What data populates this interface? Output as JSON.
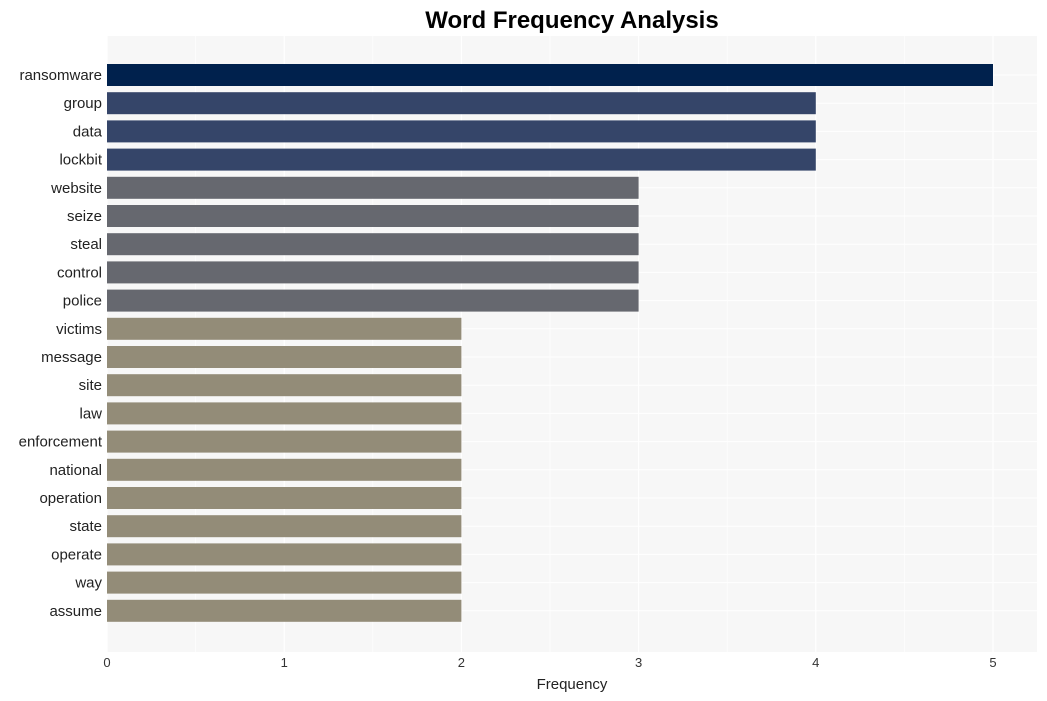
{
  "chart_data": {
    "type": "bar",
    "orientation": "horizontal",
    "title": "Word Frequency Analysis",
    "xlabel": "Frequency",
    "ylabel": "",
    "xlim": [
      0,
      5.25
    ],
    "xticks": [
      0,
      1,
      2,
      3,
      4,
      5
    ],
    "grid": true,
    "legend": "none",
    "categories": [
      "ransomware",
      "group",
      "data",
      "lockbit",
      "website",
      "seize",
      "steal",
      "control",
      "police",
      "victims",
      "message",
      "site",
      "law",
      "enforcement",
      "national",
      "operation",
      "state",
      "operate",
      "way",
      "assume"
    ],
    "values": [
      5,
      4,
      4,
      4,
      3,
      3,
      3,
      3,
      3,
      2,
      2,
      2,
      2,
      2,
      2,
      2,
      2,
      2,
      2,
      2
    ],
    "colors_by_value": {
      "5": "#00214d",
      "4": "#354569",
      "3": "#66686f",
      "2": "#938c78"
    },
    "background": "#f7f7f7",
    "gridline_color": "#ffffff"
  }
}
